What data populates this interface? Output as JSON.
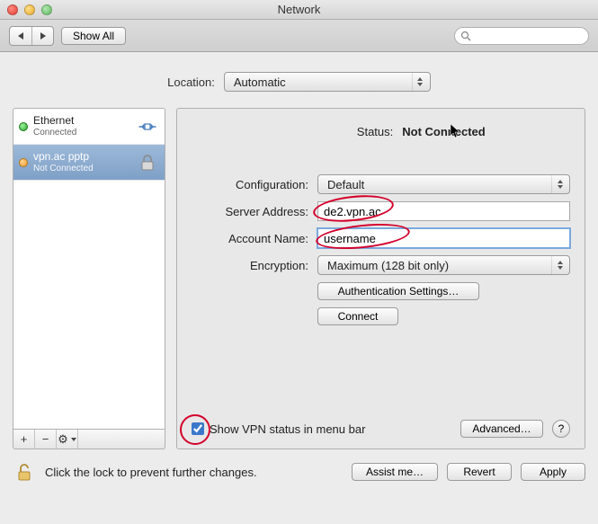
{
  "window": {
    "title": "Network"
  },
  "toolbar": {
    "show_all": "Show All",
    "search_placeholder": ""
  },
  "location": {
    "label": "Location:",
    "value": "Automatic"
  },
  "sidebar": {
    "items": [
      {
        "name": "Ethernet",
        "status": "Connected",
        "dot": "green",
        "icon": "ethernet"
      },
      {
        "name": "vpn.ac pptp",
        "status": "Not Connected",
        "dot": "orange",
        "icon": "lock"
      }
    ],
    "selected_index": 1,
    "buttons": {
      "add": "+",
      "remove": "−",
      "gear": "⚙"
    }
  },
  "main": {
    "status_label": "Status:",
    "status_value": "Not Connected",
    "configuration_label": "Configuration:",
    "configuration_value": "Default",
    "server_address_label": "Server Address:",
    "server_address_value": "de2.vpn.ac",
    "account_name_label": "Account Name:",
    "account_name_value": "username",
    "encryption_label": "Encryption:",
    "encryption_value": "Maximum (128 bit only)",
    "auth_settings_label": "Authentication Settings…",
    "connect_label": "Connect",
    "show_vpn_label": "Show VPN status in menu bar",
    "show_vpn_checked": true,
    "advanced_label": "Advanced…",
    "help_label": "?"
  },
  "footer": {
    "lock_text": "Click the lock to prevent further changes.",
    "assist": "Assist me…",
    "revert": "Revert",
    "apply": "Apply"
  }
}
